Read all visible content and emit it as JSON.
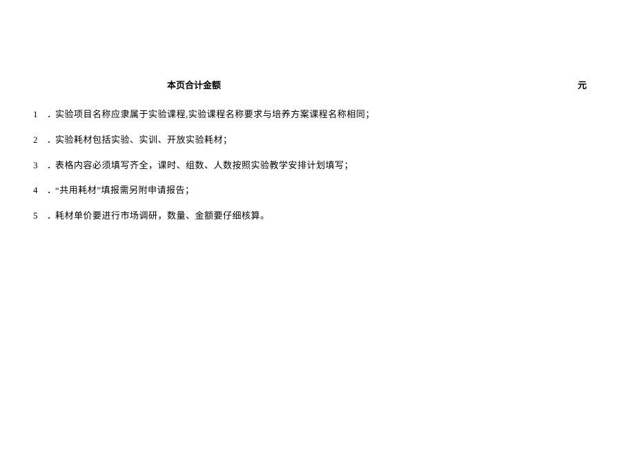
{
  "header": {
    "title": "本页合计金额",
    "unit": "元"
  },
  "notes": [
    {
      "num": "1",
      "dot": "．",
      "text": "实验项目名称应隶属于实验课程,实验课程名称要求与培养方案课程名称相同；"
    },
    {
      "num": "2",
      "dot": "．",
      "text": "实验耗材包括实验、实训、开放实验耗材；"
    },
    {
      "num": "3",
      "dot": "．",
      "text": "表格内容必须填写齐全，课时、组数、人数按照实验教学安排计划填写；"
    },
    {
      "num": "4",
      "dot": "．",
      "text": "“共用耗材”填报需另附申请报告；"
    },
    {
      "num": "5",
      "dot": "．",
      "text": "耗材单价要进行市场调研，数量、金额要仔细核算。"
    }
  ]
}
